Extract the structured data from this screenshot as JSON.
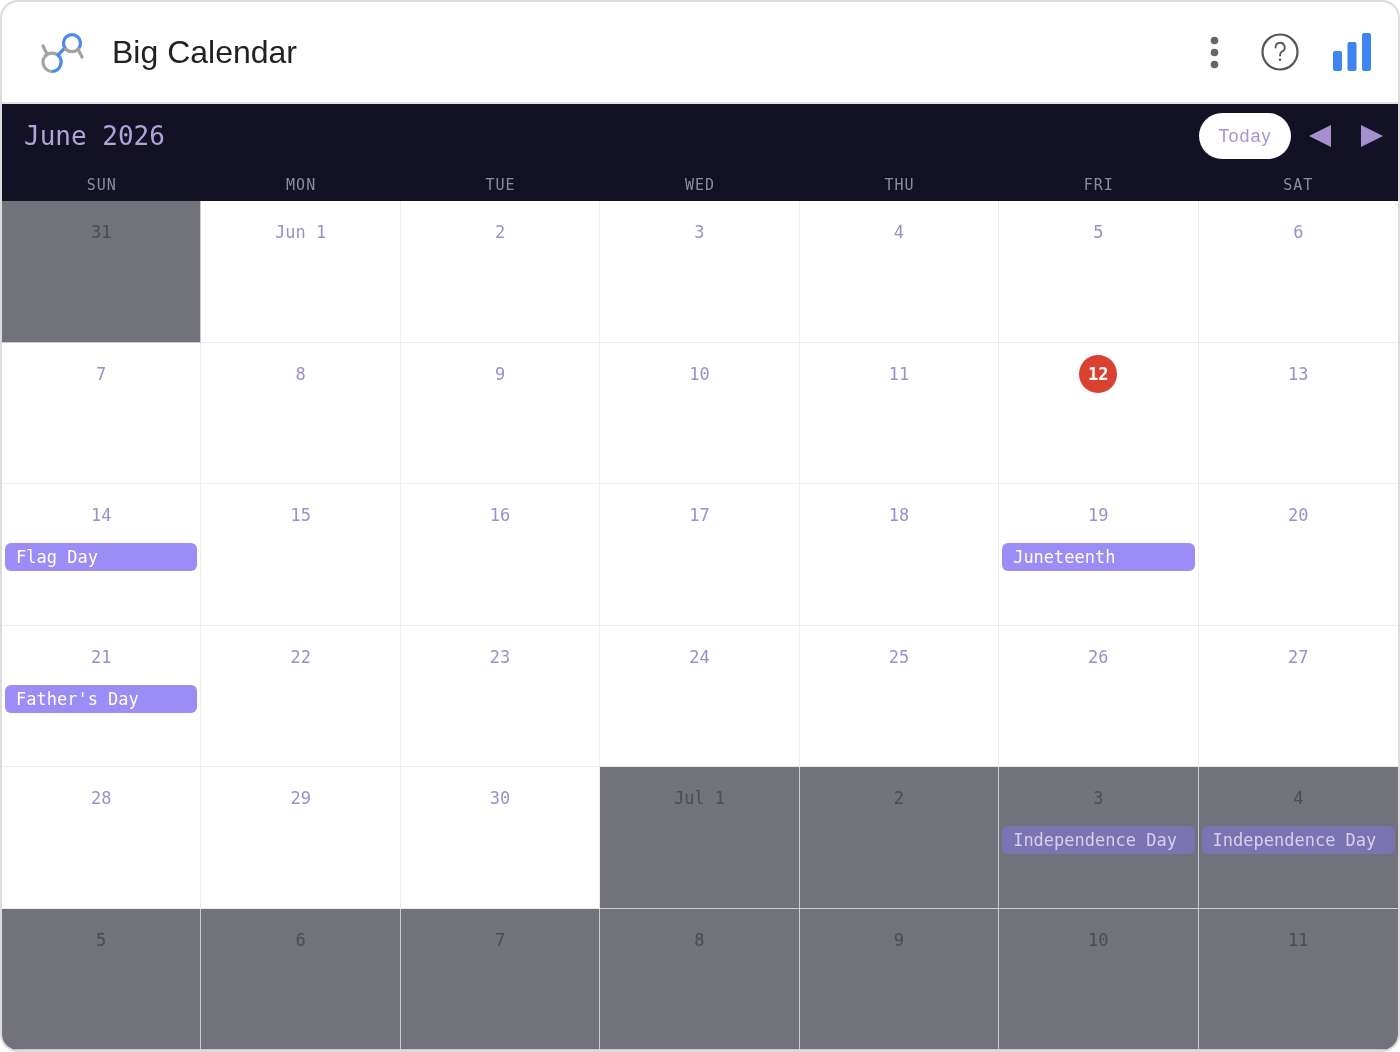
{
  "app": {
    "title": "Big Calendar"
  },
  "calendar": {
    "month_title": "June 2026",
    "today_button": "Today",
    "weekdays": [
      "SUN",
      "MON",
      "TUE",
      "WED",
      "THU",
      "FRI",
      "SAT"
    ],
    "weeks": [
      {
        "days": [
          {
            "label": "31",
            "outside_month": true,
            "today": false
          },
          {
            "label": "Jun 1",
            "outside_month": false,
            "today": false
          },
          {
            "label": "2",
            "outside_month": false,
            "today": false
          },
          {
            "label": "3",
            "outside_month": false,
            "today": false
          },
          {
            "label": "4",
            "outside_month": false,
            "today": false
          },
          {
            "label": "5",
            "outside_month": false,
            "today": false
          },
          {
            "label": "6",
            "outside_month": false,
            "today": false
          }
        ]
      },
      {
        "days": [
          {
            "label": "7",
            "outside_month": false,
            "today": false
          },
          {
            "label": "8",
            "outside_month": false,
            "today": false
          },
          {
            "label": "9",
            "outside_month": false,
            "today": false
          },
          {
            "label": "10",
            "outside_month": false,
            "today": false
          },
          {
            "label": "11",
            "outside_month": false,
            "today": false
          },
          {
            "label": "12",
            "outside_month": false,
            "today": true
          },
          {
            "label": "13",
            "outside_month": false,
            "today": false
          }
        ]
      },
      {
        "days": [
          {
            "label": "14",
            "outside_month": false,
            "today": false,
            "events": [
              {
                "title": "Flag Day"
              }
            ]
          },
          {
            "label": "15",
            "outside_month": false,
            "today": false
          },
          {
            "label": "16",
            "outside_month": false,
            "today": false
          },
          {
            "label": "17",
            "outside_month": false,
            "today": false
          },
          {
            "label": "18",
            "outside_month": false,
            "today": false
          },
          {
            "label": "19",
            "outside_month": false,
            "today": false,
            "events": [
              {
                "title": "Juneteenth"
              }
            ]
          },
          {
            "label": "20",
            "outside_month": false,
            "today": false
          }
        ]
      },
      {
        "days": [
          {
            "label": "21",
            "outside_month": false,
            "today": false,
            "events": [
              {
                "title": "Father's Day"
              }
            ]
          },
          {
            "label": "22",
            "outside_month": false,
            "today": false
          },
          {
            "label": "23",
            "outside_month": false,
            "today": false
          },
          {
            "label": "24",
            "outside_month": false,
            "today": false
          },
          {
            "label": "25",
            "outside_month": false,
            "today": false
          },
          {
            "label": "26",
            "outside_month": false,
            "today": false
          },
          {
            "label": "27",
            "outside_month": false,
            "today": false
          }
        ]
      },
      {
        "days": [
          {
            "label": "28",
            "outside_month": false,
            "today": false
          },
          {
            "label": "29",
            "outside_month": false,
            "today": false
          },
          {
            "label": "30",
            "outside_month": false,
            "today": false
          },
          {
            "label": "Jul 1",
            "outside_month": true,
            "today": false
          },
          {
            "label": "2",
            "outside_month": true,
            "today": false
          },
          {
            "label": "3",
            "outside_month": true,
            "today": false,
            "events": [
              {
                "title": "Independence Day"
              }
            ]
          },
          {
            "label": "4",
            "outside_month": true,
            "today": false,
            "events": [
              {
                "title": "Independence Day"
              }
            ]
          }
        ]
      },
      {
        "days": [
          {
            "label": "5",
            "outside_month": true,
            "today": false
          },
          {
            "label": "6",
            "outside_month": true,
            "today": false
          },
          {
            "label": "7",
            "outside_month": true,
            "today": false
          },
          {
            "label": "8",
            "outside_month": true,
            "today": false
          },
          {
            "label": "9",
            "outside_month": true,
            "today": false
          },
          {
            "label": "10",
            "outside_month": true,
            "today": false
          },
          {
            "label": "11",
            "outside_month": true,
            "today": false
          }
        ]
      }
    ]
  }
}
